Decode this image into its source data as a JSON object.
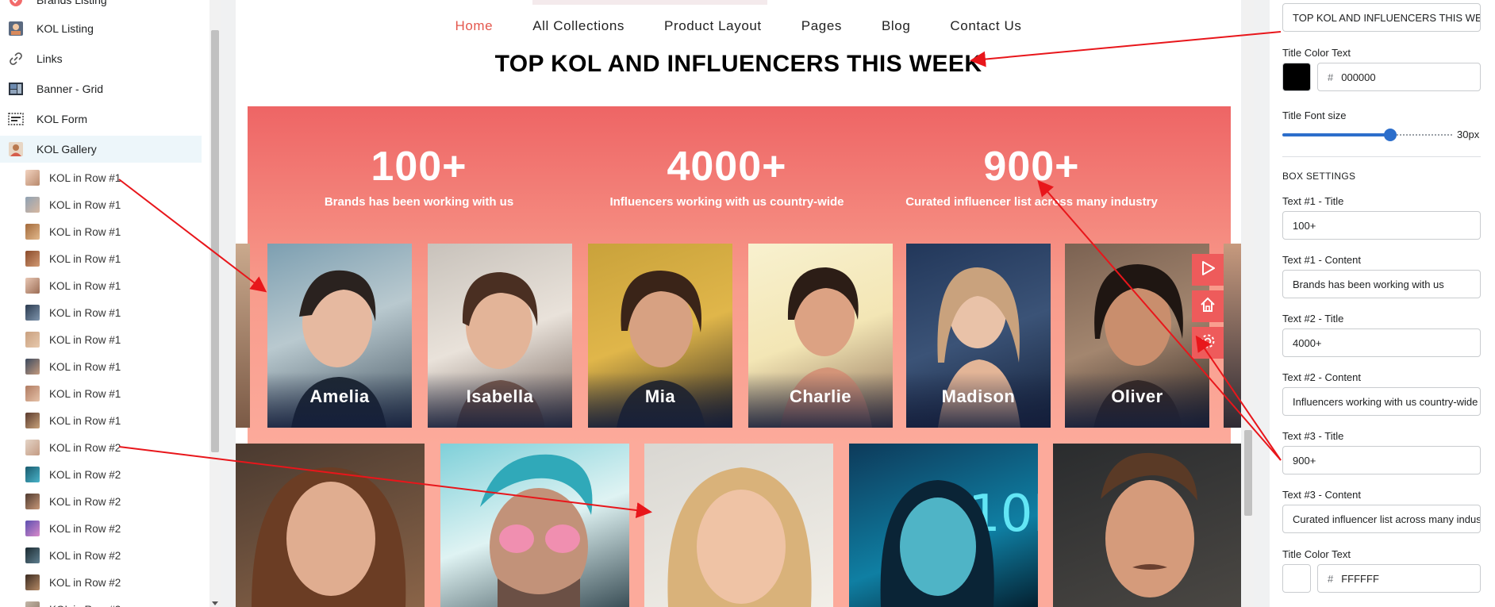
{
  "sidebar": {
    "top_items": [
      {
        "label": "Brands Listing",
        "icon": "brand-icon"
      },
      {
        "label": "KOL Listing",
        "icon": "kol-listing-icon"
      },
      {
        "label": "Links",
        "icon": "link-icon"
      },
      {
        "label": "Banner - Grid",
        "icon": "banner-grid-icon"
      },
      {
        "label": "KOL Form",
        "icon": "form-icon"
      },
      {
        "label": "KOL Gallery",
        "icon": "gallery-icon"
      }
    ],
    "children": [
      "KOL in Row #1",
      "KOL in Row #1",
      "KOL in Row #1",
      "KOL in Row #1",
      "KOL in Row #1",
      "KOL in Row #1",
      "KOL in Row #1",
      "KOL in Row #1",
      "KOL in Row #1",
      "KOL in Row #1",
      "KOL in Row #2",
      "KOL in Row #2",
      "KOL in Row #2",
      "KOL in Row #2",
      "KOL in Row #2",
      "KOL in Row #2",
      "KOL in Row #2"
    ]
  },
  "preview": {
    "nav": [
      "Home",
      "All Collections",
      "Product Layout",
      "Pages",
      "Blog",
      "Contact Us"
    ],
    "nav_active": "Home",
    "title": "TOP KOL AND INFLUENCERS THIS WEEK",
    "stats": [
      {
        "number": "100+",
        "text": "Brands has been working with us"
      },
      {
        "number": "4000+",
        "text": "Influencers working with us country-wide"
      },
      {
        "number": "900+",
        "text": "Curated influencer list across many industry"
      }
    ],
    "row1_names": [
      "Amelia",
      "Isabella",
      "Mia",
      "Charlie",
      "Madison",
      "Oliver"
    ],
    "fab_icons": [
      "play-icon",
      "home-icon",
      "gear-icon"
    ]
  },
  "settings": {
    "title_value": "TOP KOL AND INFLUENCERS THIS WEEK",
    "title_color_label": "Title Color Text",
    "title_color_hex": "000000",
    "title_font_size_label": "Title Font size",
    "title_font_size_value": "30px",
    "box_settings_heading": "BOX SETTINGS",
    "text1_title_label": "Text #1 - Title",
    "text1_title_value": "100+",
    "text1_content_label": "Text #1 - Content",
    "text1_content_value": "Brands has been working with us",
    "text2_title_label": "Text #2 - Title",
    "text2_title_value": "4000+",
    "text2_content_label": "Text #2 - Content",
    "text2_content_value": "Influencers working with us country-wide",
    "text3_title_label": "Text #3 - Title",
    "text3_title_value": "900+",
    "text3_content_label": "Text #3 - Content",
    "text3_content_value": "Curated influencer list across many industry",
    "title_color2_label": "Title Color Text",
    "title_color2_hex": "FFFFFF"
  },
  "colors": {
    "accent": "#e4584e",
    "stats_top": "#ee6565",
    "stats_bottom": "#fcaa9b",
    "slider": "#2c6ecb",
    "arrow": "#e8161b"
  }
}
